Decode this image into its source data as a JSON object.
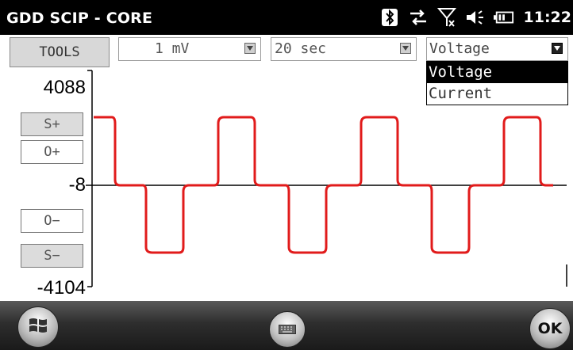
{
  "titlebar": {
    "app_title": "GDD SCIP - CORE",
    "time": "11:22"
  },
  "toolbar": {
    "tools_label": "TOOLS",
    "sensitivity": {
      "value": "1 mV"
    },
    "timebase": {
      "value": "20 sec"
    },
    "mode": {
      "value": "Voltage",
      "options": [
        "Voltage",
        "Current"
      ],
      "selected_index": 0
    }
  },
  "scale": {
    "top_label": "4088",
    "mid_label": "-8",
    "bottom_label": "-4104"
  },
  "side_buttons": {
    "s_plus": "S+",
    "o_plus": "O+",
    "o_minus": "O−",
    "s_minus": "S−"
  },
  "taskbar": {
    "ok_label": "OK"
  },
  "colors": {
    "trace": "#e11b1b",
    "titlebar_bg": "#000000",
    "dropdown_selected_bg": "#000000"
  }
}
